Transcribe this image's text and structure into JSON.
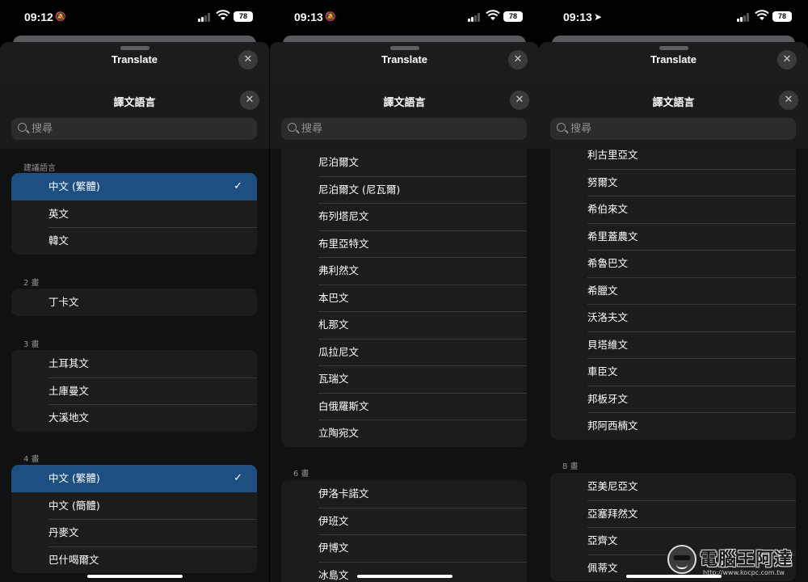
{
  "colors": {
    "accent": "#1d4f82",
    "sheet": "#1c1c1e",
    "background": "#000000"
  },
  "common": {
    "sheet_title": "Translate",
    "close_symbol": "✕",
    "picker_title": "譯文語言",
    "search_placeholder": "搜尋",
    "battery": "78"
  },
  "panels": [
    {
      "time": "09:12",
      "status_icon": "bell-slash-icon",
      "sections": [
        {
          "header": "建議語言",
          "items": [
            {
              "label": "中文 (繁體)",
              "selected": true
            },
            {
              "label": "英文"
            },
            {
              "label": "韓文"
            }
          ]
        },
        {
          "header": "2 畫",
          "items": [
            {
              "label": "丁卡文"
            }
          ]
        },
        {
          "header": "3 畫",
          "items": [
            {
              "label": "土耳其文"
            },
            {
              "label": "土庫曼文"
            },
            {
              "label": "大溪地文"
            }
          ]
        },
        {
          "header": "4 畫",
          "items": [
            {
              "label": "中文 (繁體)",
              "selected": true
            },
            {
              "label": "中文 (簡體)"
            },
            {
              "label": "丹麥文"
            },
            {
              "label": "巴什喝爾文"
            }
          ]
        }
      ]
    },
    {
      "time": "09:13",
      "status_icon": "bell-slash-icon",
      "sections": [
        {
          "header": "",
          "items": [
            {
              "label": "尼泊爾文"
            },
            {
              "label": "尼泊爾文 (尼瓦爾)"
            },
            {
              "label": "布列塔尼文"
            },
            {
              "label": "布里亞特文"
            },
            {
              "label": "弗利然文"
            },
            {
              "label": "本巴文"
            },
            {
              "label": "札那文"
            },
            {
              "label": "瓜拉尼文"
            },
            {
              "label": "瓦瑞文"
            },
            {
              "label": "白俄羅斯文"
            },
            {
              "label": "立陶宛文"
            }
          ]
        },
        {
          "header": "6 畫",
          "items": [
            {
              "label": "伊洛卡諾文"
            },
            {
              "label": "伊班文"
            },
            {
              "label": "伊博文"
            },
            {
              "label": "冰島文"
            }
          ]
        }
      ]
    },
    {
      "time": "09:13",
      "status_icon": "location-arrow-icon",
      "sections": [
        {
          "header": "",
          "items": [
            {
              "label": "利古里亞文"
            },
            {
              "label": "努爾文"
            },
            {
              "label": "希伯來文"
            },
            {
              "label": "希里蓋農文"
            },
            {
              "label": "希魯巴文"
            },
            {
              "label": "希臘文"
            },
            {
              "label": "沃洛夫文"
            },
            {
              "label": "貝塔維文"
            },
            {
              "label": "車臣文"
            },
            {
              "label": "邦板牙文"
            },
            {
              "label": "邦阿西楠文"
            }
          ]
        },
        {
          "header": "8 畫",
          "items": [
            {
              "label": "亞美尼亞文"
            },
            {
              "label": "亞塞拜然文"
            },
            {
              "label": "亞齊文"
            },
            {
              "label": "佩蒂文"
            }
          ]
        }
      ]
    }
  ],
  "watermark": {
    "text": "電腦王阿達",
    "url": "http://www.kocpc.com.tw"
  }
}
